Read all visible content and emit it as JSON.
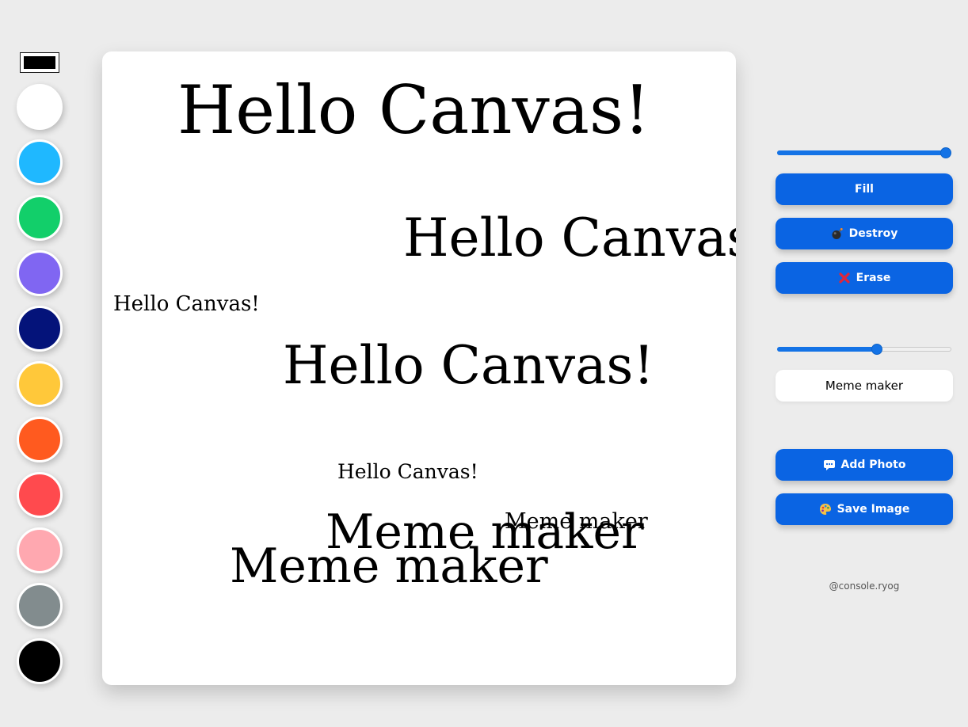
{
  "color_picker": {
    "value": "#000000"
  },
  "color_options": [
    "#ffffff",
    "#1fb8ff",
    "#12cf6a",
    "#8066f2",
    "#04137a",
    "#ffc83a",
    "#ff5a1f",
    "#ff4a4e",
    "#ffa8b0",
    "#828c8e",
    "#000000"
  ],
  "canvas": {
    "texts": [
      {
        "text": "Hello Canvas!"
      },
      {
        "text": "Hello Canvas!"
      },
      {
        "text": "Hello Canvas!"
      },
      {
        "text": "Hello Canvas!"
      },
      {
        "text": "Hello Canvas!"
      },
      {
        "text": "Meme maker"
      },
      {
        "text": "Meme maker"
      },
      {
        "text": "Meme maker"
      }
    ]
  },
  "controls": {
    "line_width_level": 1.0,
    "font_size_level": 0.58,
    "fill_label": "Fill",
    "destroy_label": "Destroy",
    "erase_label": "Erase",
    "text_value": "Meme maker",
    "add_photo_label": "Add Photo",
    "save_image_label": "Save Image",
    "credit": "@console.ryog",
    "accent_color": "#0a64e3"
  }
}
